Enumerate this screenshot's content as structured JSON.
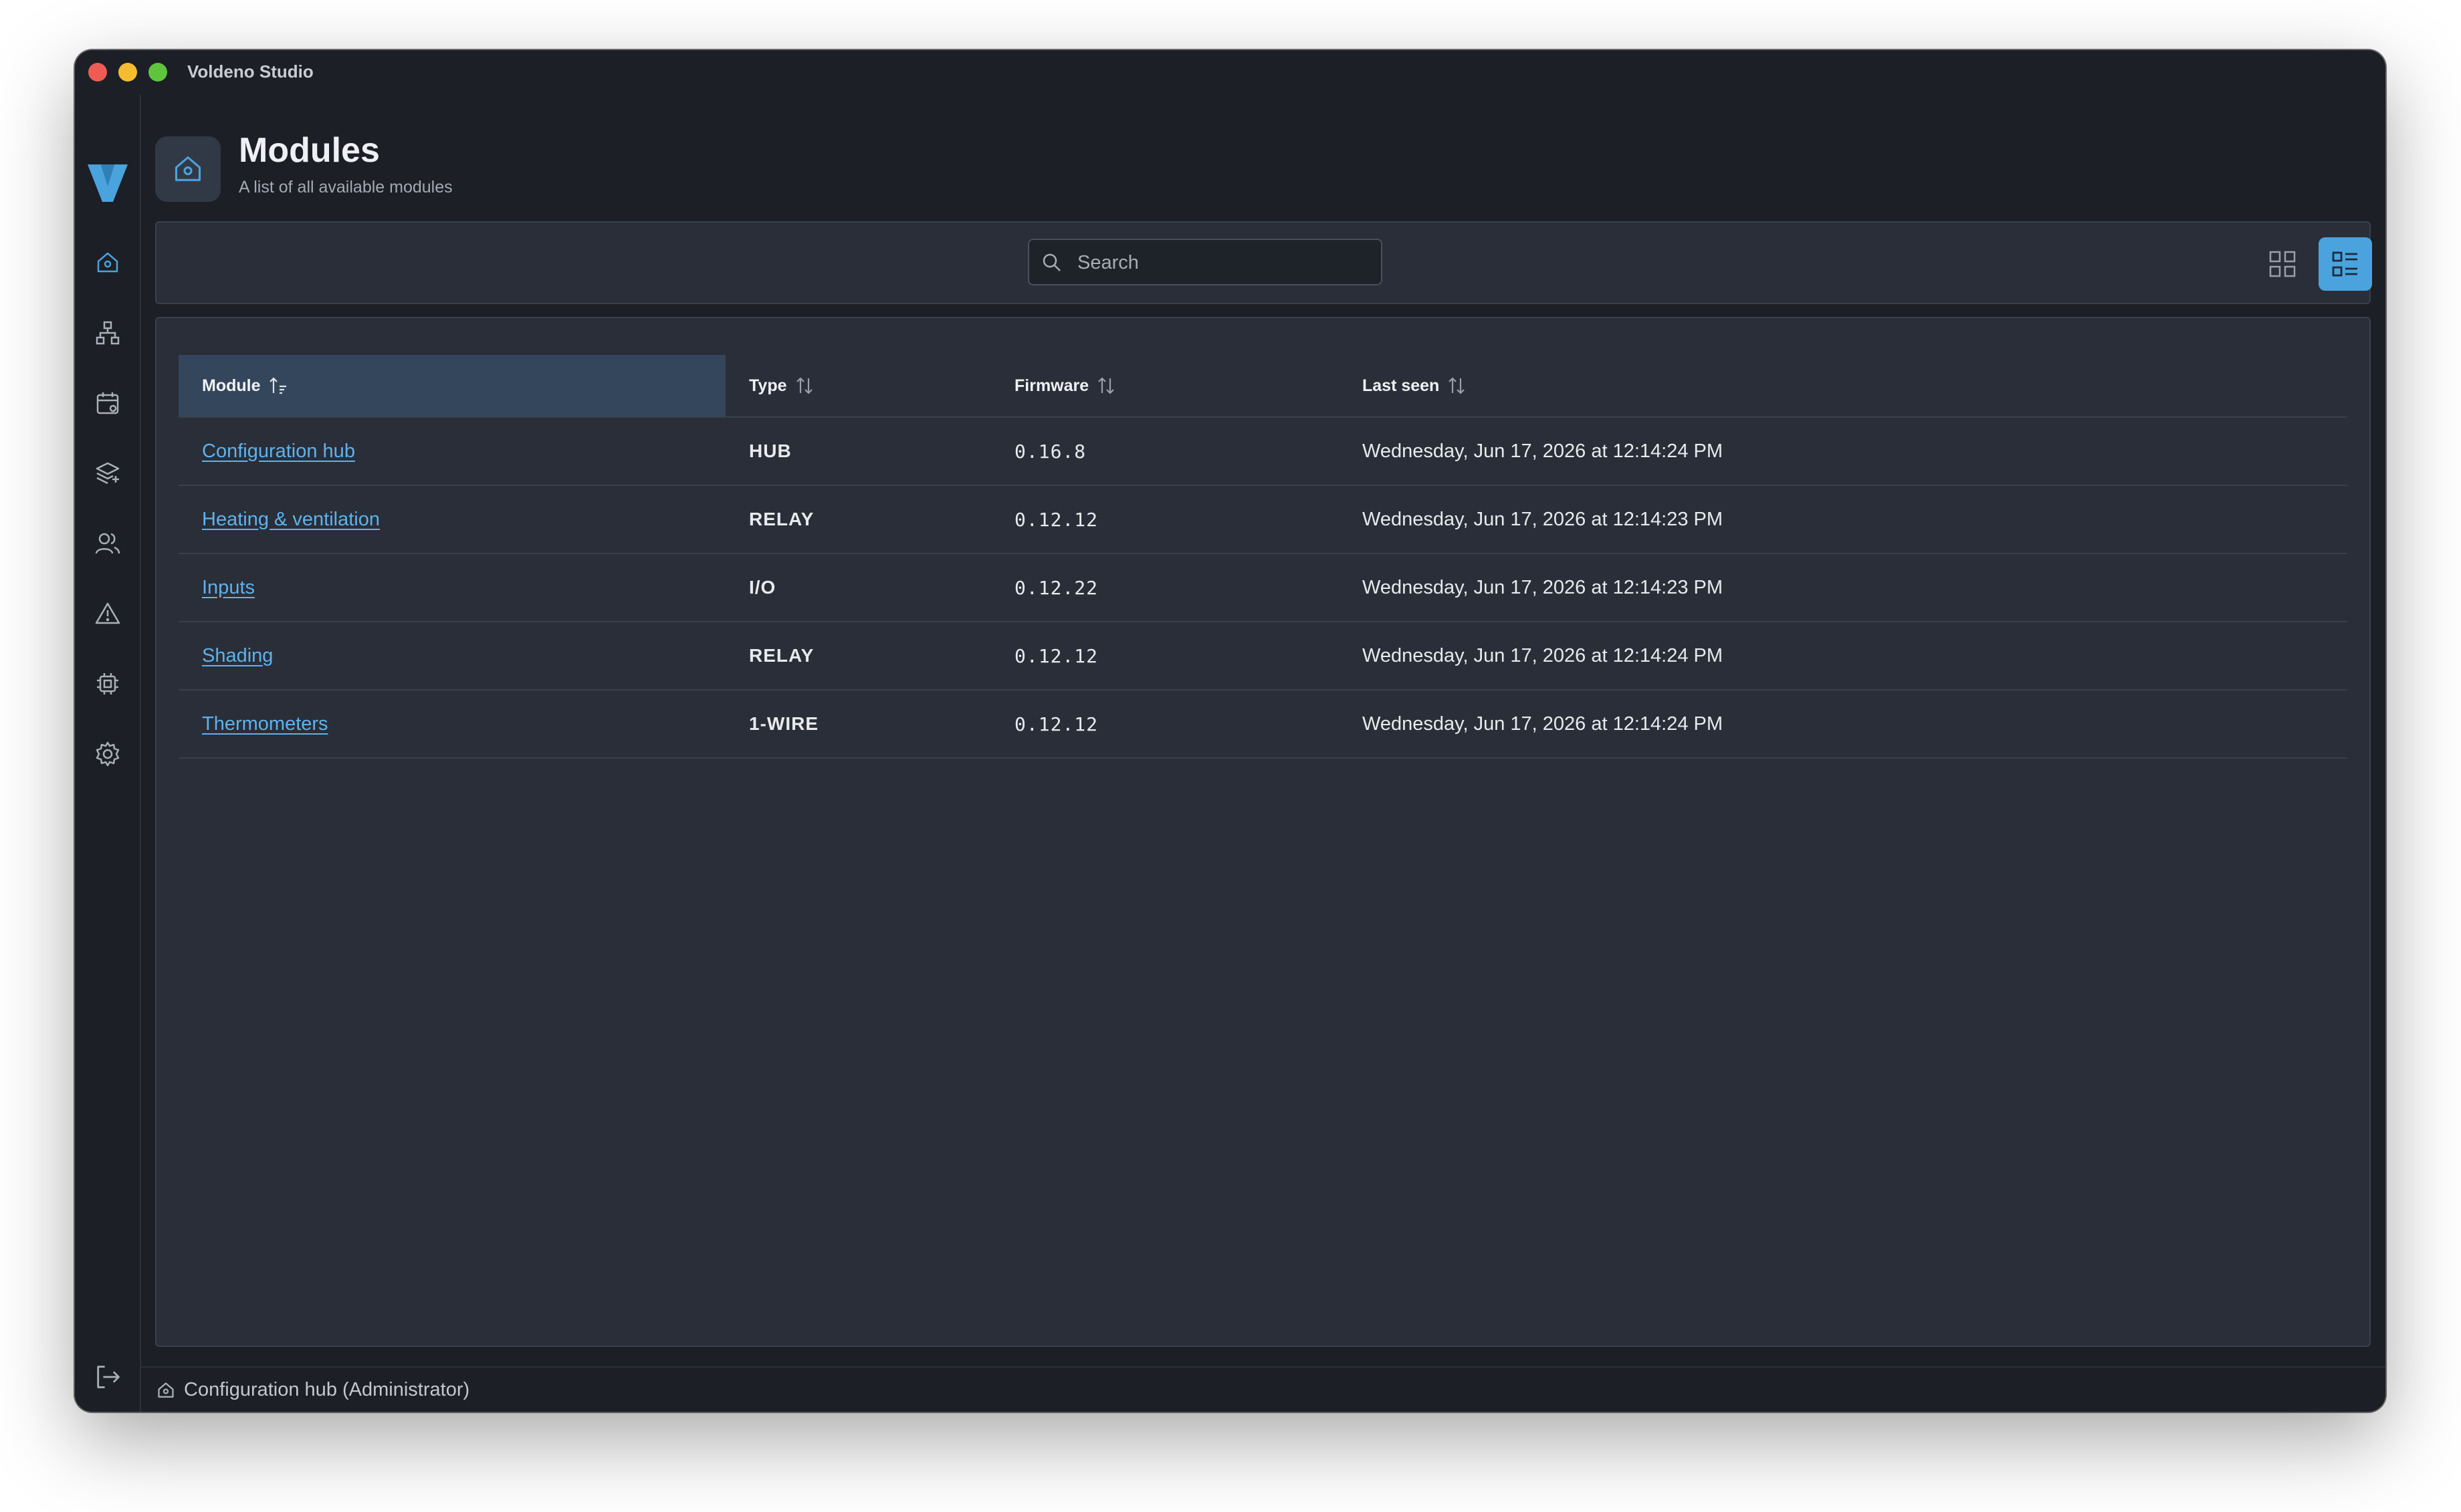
{
  "window": {
    "title": "Voldeno Studio"
  },
  "sidebar": {
    "items": [
      {
        "name": "home",
        "icon": "home-icon"
      },
      {
        "name": "network",
        "icon": "network-icon"
      },
      {
        "name": "schedule",
        "icon": "calendar-icon"
      },
      {
        "name": "layers",
        "icon": "layers-icon"
      },
      {
        "name": "users",
        "icon": "users-icon"
      },
      {
        "name": "alerts",
        "icon": "warning-icon"
      },
      {
        "name": "modules",
        "icon": "chip-icon"
      },
      {
        "name": "settings",
        "icon": "gear-icon"
      }
    ],
    "logout_icon": "logout-icon"
  },
  "header": {
    "title": "Modules",
    "subtitle": "A list of all available modules"
  },
  "search": {
    "placeholder": "Search",
    "value": ""
  },
  "view_toggle": {
    "active": "list"
  },
  "table": {
    "columns": [
      "Module",
      "Type",
      "Firmware",
      "Last seen"
    ],
    "sorted_column": "Module",
    "rows": [
      {
        "module": "Configuration hub",
        "type": "HUB",
        "firmware": "0.16.8",
        "last_seen": "Wednesday, Jun 17, 2026 at 12:14:24 PM"
      },
      {
        "module": "Heating & ventilation",
        "type": "RELAY",
        "firmware": "0.12.12",
        "last_seen": "Wednesday, Jun 17, 2026 at 12:14:23 PM"
      },
      {
        "module": "Inputs",
        "type": "I/O",
        "firmware": "0.12.22",
        "last_seen": "Wednesday, Jun 17, 2026 at 12:14:23 PM"
      },
      {
        "module": "Shading",
        "type": "RELAY",
        "firmware": "0.12.12",
        "last_seen": "Wednesday, Jun 17, 2026 at 12:14:24 PM"
      },
      {
        "module": "Thermometers",
        "type": "1-WIRE",
        "firmware": "0.12.12",
        "last_seen": "Wednesday, Jun 17, 2026 at 12:14:24 PM"
      }
    ]
  },
  "status": {
    "text": "Configuration hub (Administrator)"
  },
  "colors": {
    "accent": "#4aa3dd",
    "link": "#5fb2ec",
    "background": "#1c1f25",
    "panel": "#292e38"
  }
}
